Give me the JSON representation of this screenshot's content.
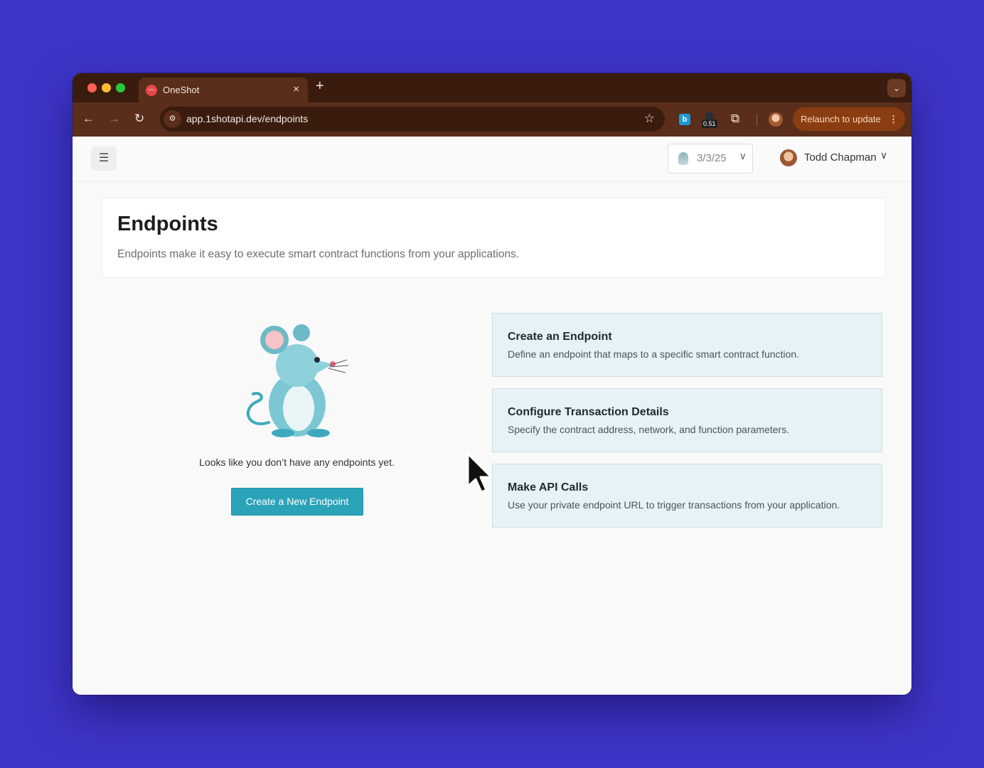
{
  "browser": {
    "tab": {
      "favicon": "oneshot-logo",
      "title": "OneShot",
      "close": "×"
    },
    "new_tab": "+",
    "tab_search": "⌄",
    "nav": {
      "back": "←",
      "forward": "→",
      "reload": "↻"
    },
    "address": {
      "site_info_icon": "tune-icon",
      "url": "app.1shotapi.dev/endpoints",
      "bookmark": "☆"
    },
    "extensions": [
      {
        "name": "bitwarden-extension",
        "label": "b"
      },
      {
        "name": "meter-extension",
        "badge": "0.51"
      }
    ],
    "puzzle": "⧉",
    "relaunch": {
      "label": "Relaunch to update",
      "menu": "⋮"
    }
  },
  "topbar": {
    "menu_icon": "☰",
    "date": {
      "value": "3/3/25",
      "chevron": "∨"
    },
    "user": {
      "name": "Todd Chapman",
      "chevron": "∨"
    }
  },
  "header": {
    "title": "Endpoints",
    "subtitle": "Endpoints make it easy to execute smart contract functions from your applications."
  },
  "empty_state": {
    "message": "Looks like you don’t have any endpoints yet.",
    "button": "Create a New Endpoint"
  },
  "steps": [
    {
      "title": "Create an Endpoint",
      "description": "Define an endpoint that maps to a specific smart contract function."
    },
    {
      "title": "Configure Transaction Details",
      "description": "Specify the contract address, network, and function parameters."
    },
    {
      "title": "Make API Calls",
      "description": "Use your private endpoint URL to trigger transactions from your application."
    }
  ],
  "colors": {
    "accent": "#2aa3b8",
    "background": "#3d35c8",
    "step_card": "#e6f3f6"
  }
}
